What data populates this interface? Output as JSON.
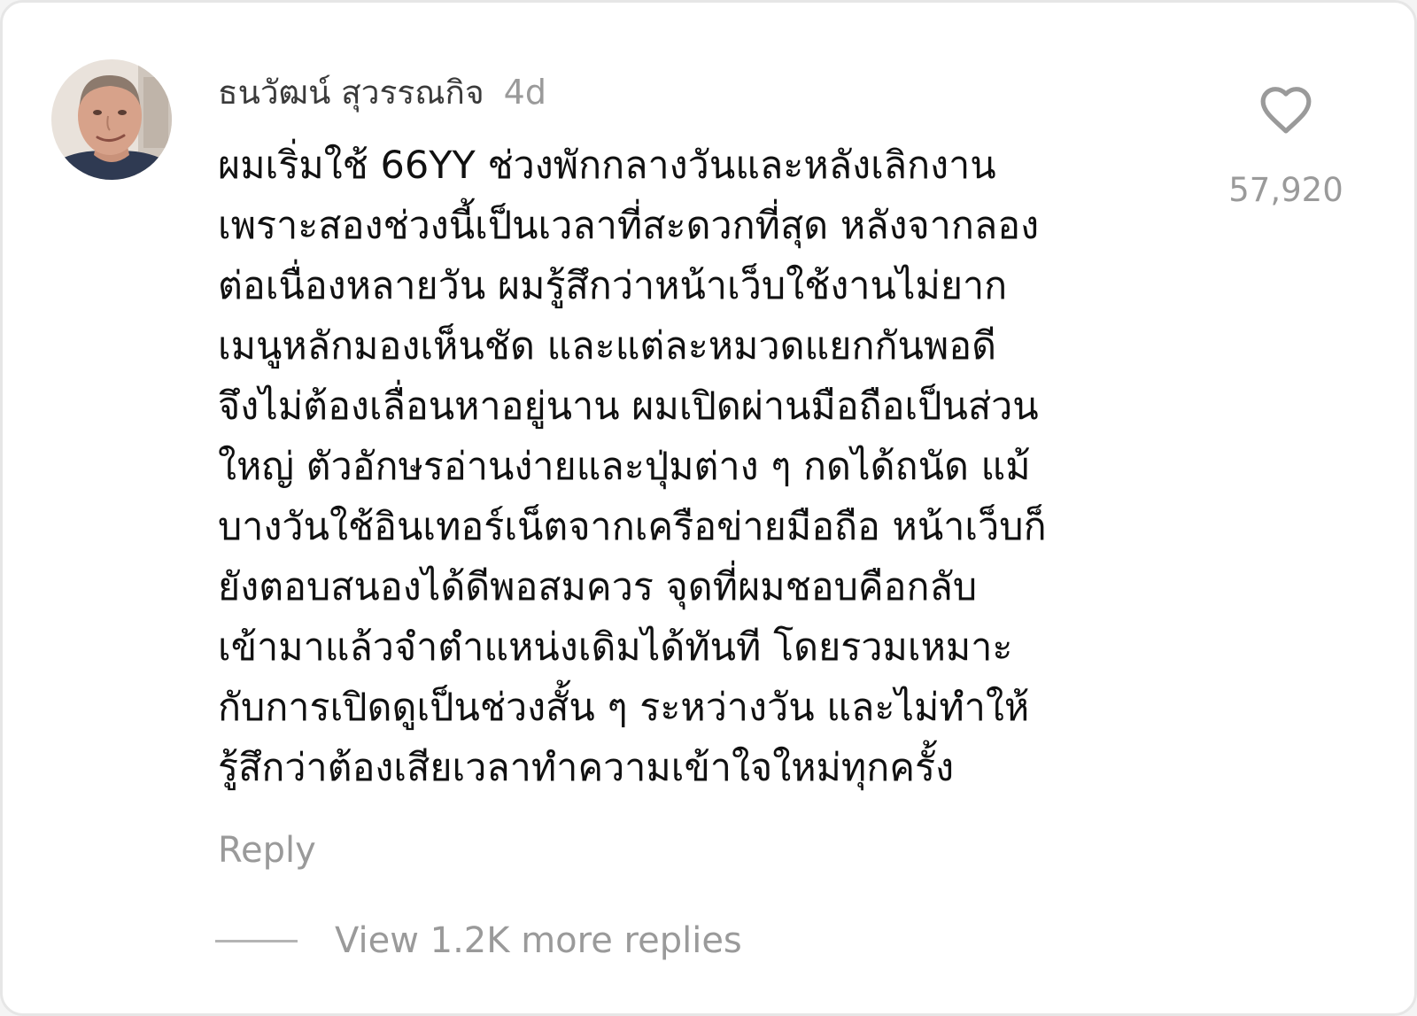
{
  "comment": {
    "author": "ธนวัฒน์ สุวรรณกิจ",
    "time": "4d",
    "lines": [
      "ผมเริ่มใช้ 66YY ช่วงพักกลางวันและหลังเลิกงาน",
      "เพราะสองช่วงนี้เป็นเวลาที่สะดวกที่สุด หลังจากลอง",
      "ต่อเนื่องหลายวัน ผมรู้สึกว่าหน้าเว็บใช้งานไม่ยาก",
      "เมนูหลักมองเห็นชัด และแต่ละหมวดแยกกันพอดี",
      "จึงไม่ต้องเลื่อนหาอยู่นาน ผมเปิดผ่านมือถือเป็นส่วน",
      "ใหญ่ ตัวอักษรอ่านง่ายและปุ่มต่าง ๆ กดได้ถนัด แม้",
      "บางวันใช้อินเทอร์เน็ตจากเครือข่ายมือถือ หน้าเว็บก็",
      "ยังตอบสนองได้ดีพอสมควร จุดที่ผมชอบคือกลับ",
      "เข้ามาแล้วจำตำแหน่งเดิมได้ทันที โดยรวมเหมาะ",
      "กับการเปิดดูเป็นช่วงสั้น ๆ ระหว่างวัน และไม่ทำให้",
      "รู้สึกว่าต้องเสียเวลาทำความเข้าใจใหม่ทุกครั้ง"
    ],
    "like_count": "57,920",
    "reply_label": "Reply",
    "view_replies_label": "View 1.2K more replies"
  },
  "icons": {
    "like": "heart-outline-icon",
    "avatar": "user-avatar"
  },
  "colors": {
    "background": "#ffffff",
    "text_primary": "#111111",
    "text_secondary": "#9a9a9a",
    "author": "#3a3a3a"
  }
}
